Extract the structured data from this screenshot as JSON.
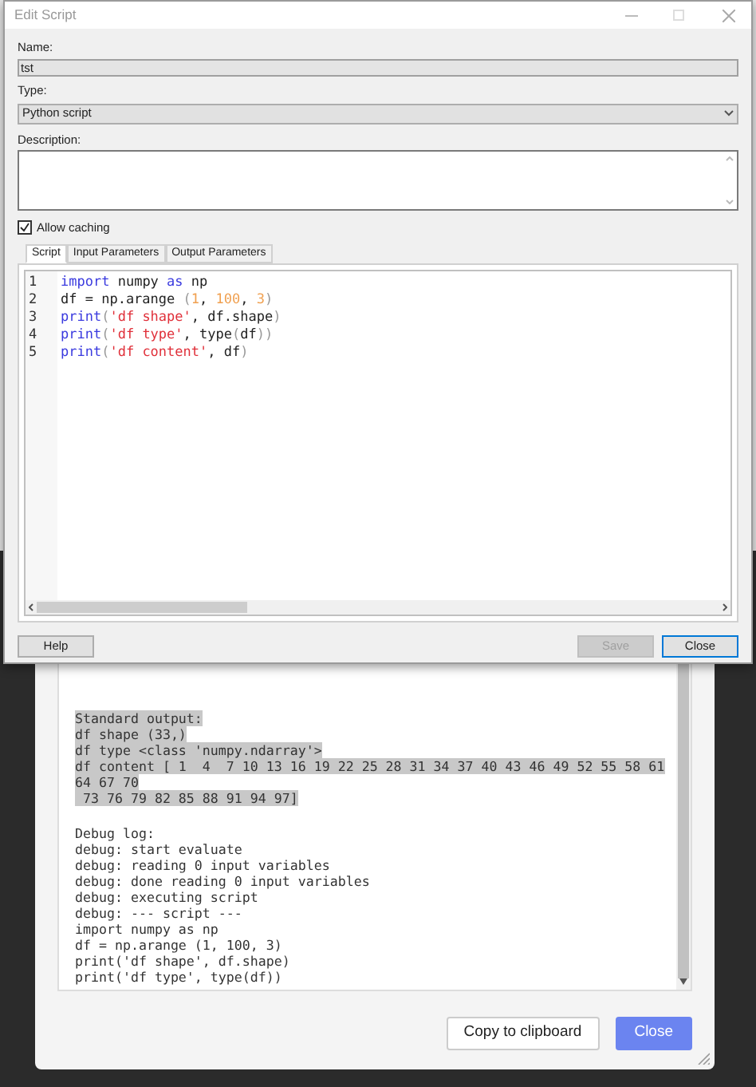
{
  "edit_window": {
    "title": "Edit Script",
    "name_label": "Name:",
    "name_value": "tst",
    "type_label": "Type:",
    "type_value": "Python script",
    "description_label": "Description:",
    "allow_caching": {
      "label": "Allow caching",
      "checked": true
    },
    "tabs": [
      {
        "label": "Script",
        "selected": true
      },
      {
        "label": "Input Parameters",
        "selected": false
      },
      {
        "label": "Output Parameters",
        "selected": false
      }
    ],
    "code_lines": [
      {
        "number": "1",
        "tokens": [
          {
            "text": "import",
            "kind": "keyword"
          },
          {
            "text": " numpy ",
            "kind": "plain"
          },
          {
            "text": "as",
            "kind": "keyword"
          },
          {
            "text": " np",
            "kind": "plain"
          }
        ]
      },
      {
        "number": "2",
        "tokens": [
          {
            "text": "df = np.arange ",
            "kind": "plain"
          },
          {
            "text": "(",
            "kind": "paren"
          },
          {
            "text": "1",
            "kind": "number"
          },
          {
            "text": ", ",
            "kind": "plain"
          },
          {
            "text": "100",
            "kind": "number"
          },
          {
            "text": ", ",
            "kind": "plain"
          },
          {
            "text": "3",
            "kind": "number"
          },
          {
            "text": ")",
            "kind": "paren"
          }
        ]
      },
      {
        "number": "3",
        "tokens": [
          {
            "text": "print",
            "kind": "keyword"
          },
          {
            "text": "(",
            "kind": "paren"
          },
          {
            "text": "'df shape'",
            "kind": "string"
          },
          {
            "text": ", df.shape",
            "kind": "plain"
          },
          {
            "text": ")",
            "kind": "paren"
          }
        ]
      },
      {
        "number": "4",
        "tokens": [
          {
            "text": "print",
            "kind": "keyword"
          },
          {
            "text": "(",
            "kind": "paren"
          },
          {
            "text": "'df type'",
            "kind": "string"
          },
          {
            "text": ", type",
            "kind": "plain"
          },
          {
            "text": "(",
            "kind": "paren"
          },
          {
            "text": "df",
            "kind": "plain"
          },
          {
            "text": "))",
            "kind": "paren"
          }
        ]
      },
      {
        "number": "5",
        "tokens": [
          {
            "text": "print",
            "kind": "keyword"
          },
          {
            "text": "(",
            "kind": "paren"
          },
          {
            "text": "'df content'",
            "kind": "string"
          },
          {
            "text": ", df",
            "kind": "plain"
          },
          {
            "text": ")",
            "kind": "paren"
          }
        ]
      }
    ],
    "buttons": [
      {
        "label": "Help",
        "disabled": false,
        "focused": false
      },
      {
        "label": "Save",
        "disabled": true,
        "focused": false
      },
      {
        "label": "Close",
        "disabled": false,
        "focused": true
      }
    ]
  },
  "output_dialog": {
    "sections": [
      {
        "lines": [
          {
            "text": "Standard output:",
            "selected": true
          },
          {
            "text": "df shape (33,)",
            "selected": true
          },
          {
            "text": "df type <class 'numpy.ndarray'>",
            "selected": true
          },
          {
            "text": "df content [ 1  4  7 10 13 16 19 22 25 28 31 34 37 40 43 46 49 52 55 58 61",
            "selected": true
          },
          {
            "text": "64 67 70",
            "selected": true
          },
          {
            "text": " 73 76 79 82 85 88 91 94 97]",
            "selected": true
          }
        ]
      },
      {
        "lines": [
          {
            "text": "Debug log:",
            "selected": false
          },
          {
            "text": "debug: start evaluate",
            "selected": false
          },
          {
            "text": "debug: reading 0 input variables",
            "selected": false
          },
          {
            "text": "debug: done reading 0 input variables",
            "selected": false
          },
          {
            "text": "debug: executing script",
            "selected": false
          },
          {
            "text": "debug: --- script ---",
            "selected": false
          },
          {
            "text": "import numpy as np",
            "selected": false
          },
          {
            "text": "df = np.arange (1, 100, 3)",
            "selected": false
          },
          {
            "text": "print('df shape', df.shape)",
            "selected": false
          },
          {
            "text": "print('df type', type(df))",
            "selected": false
          }
        ]
      }
    ],
    "buttons": [
      {
        "label": "Copy to clipboard",
        "kind": "secondary"
      },
      {
        "label": "Close",
        "kind": "primary"
      }
    ]
  }
}
